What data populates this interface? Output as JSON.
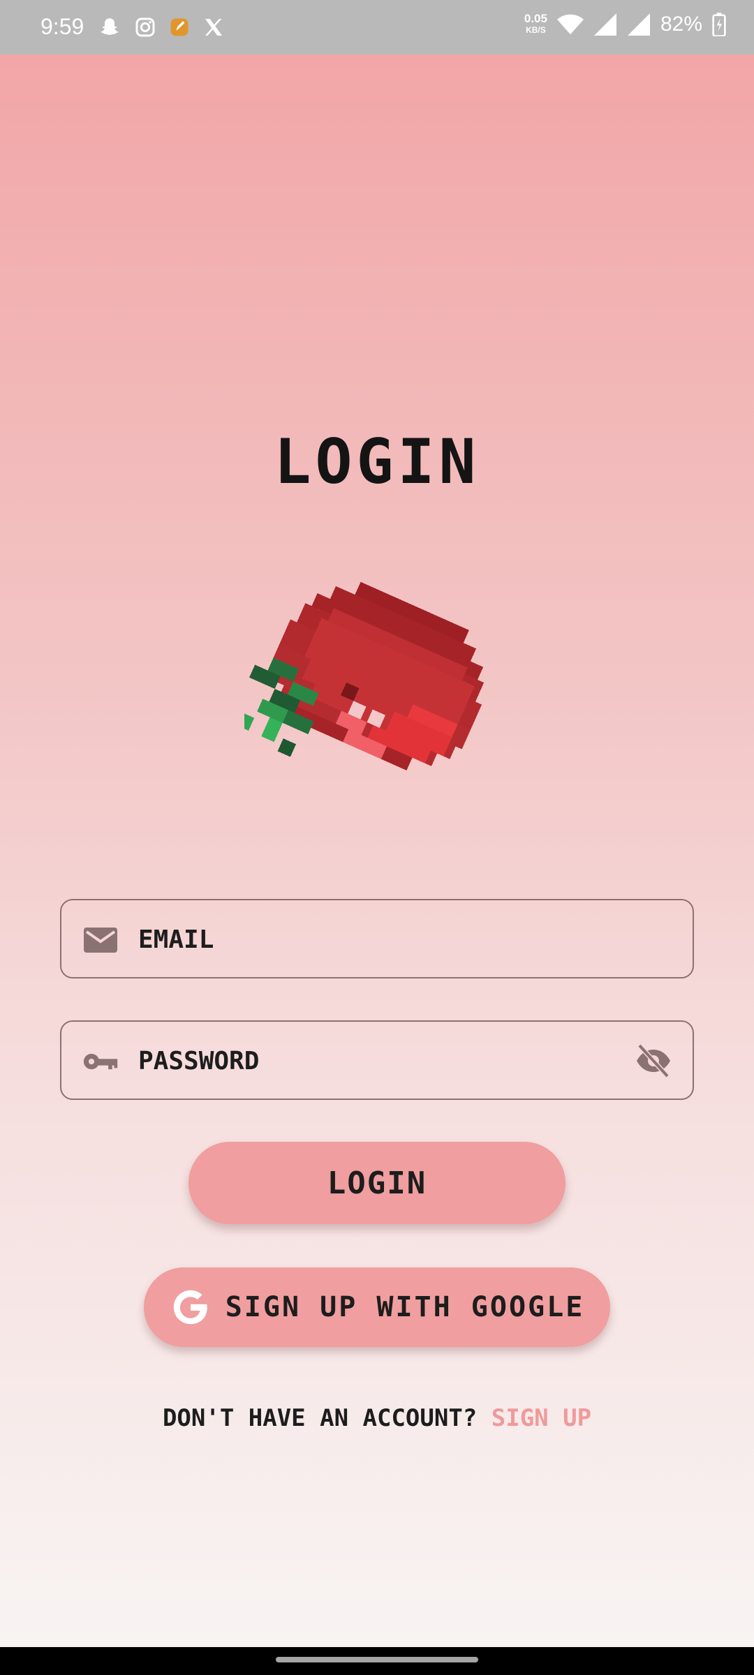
{
  "status_bar": {
    "time": "9:59",
    "net_speed_value": "0.05",
    "net_speed_unit": "KB/S",
    "battery": "82%",
    "left_icons": [
      "snapchat-icon",
      "instagram-icon",
      "app-icon",
      "x-icon"
    ],
    "right_icons": [
      "wifi-icon",
      "signal-icon",
      "signal-icon",
      "battery-charging-icon"
    ]
  },
  "screen": {
    "title": "LOGIN",
    "logo_icon": "pixel-tomato-icon"
  },
  "form": {
    "email": {
      "placeholder": "EMAIL",
      "value": "",
      "icon": "mail-icon"
    },
    "password": {
      "placeholder": "PASSWORD",
      "value": "",
      "icon": "key-icon",
      "toggle_icon": "visibility-off-icon"
    }
  },
  "buttons": {
    "login_label": "LOGIN",
    "google_label": "SIGN UP WITH GOOGLE",
    "google_icon": "google-g-icon"
  },
  "footer": {
    "prompt": "DON'T HAVE AN ACCOUNT?",
    "link": "SIGN UP"
  },
  "colors": {
    "background_top": "#f2a6a7",
    "background_bottom": "#f8f4f3",
    "button": "#f09e9f",
    "link": "#ef9a9c",
    "field_border": "#8d7070",
    "status_bar": "#b9b9b9"
  }
}
